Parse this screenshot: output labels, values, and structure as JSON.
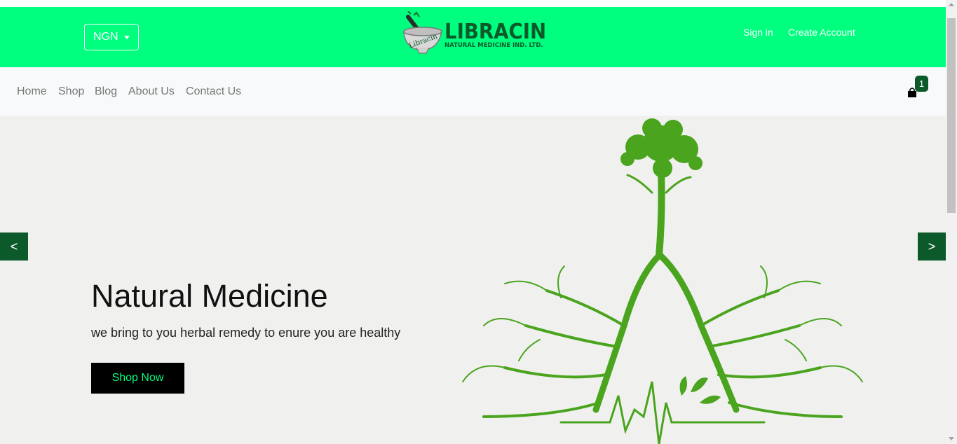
{
  "header": {
    "currency": "NGN",
    "logo_title": "LIBRACIN",
    "logo_sub": "NATURAL MEDICINE IND. LTD.",
    "logo_mortar_text": "Libracin",
    "sign_in": "Sign in",
    "create_account": "Create Account"
  },
  "nav": {
    "items": [
      "Home",
      "Shop",
      "Blog",
      "About Us",
      "Contact Us"
    ],
    "cart_count": "1"
  },
  "hero": {
    "title": "Natural Medicine",
    "subtitle": "we bring to you herbal remedy to enure you are healthy",
    "cta": "Shop Now",
    "prev": "<",
    "next": ">"
  },
  "colors": {
    "brand_green": "#00ff7f",
    "dark_green": "#0c5a2a",
    "tree_green": "#4aa41e"
  }
}
